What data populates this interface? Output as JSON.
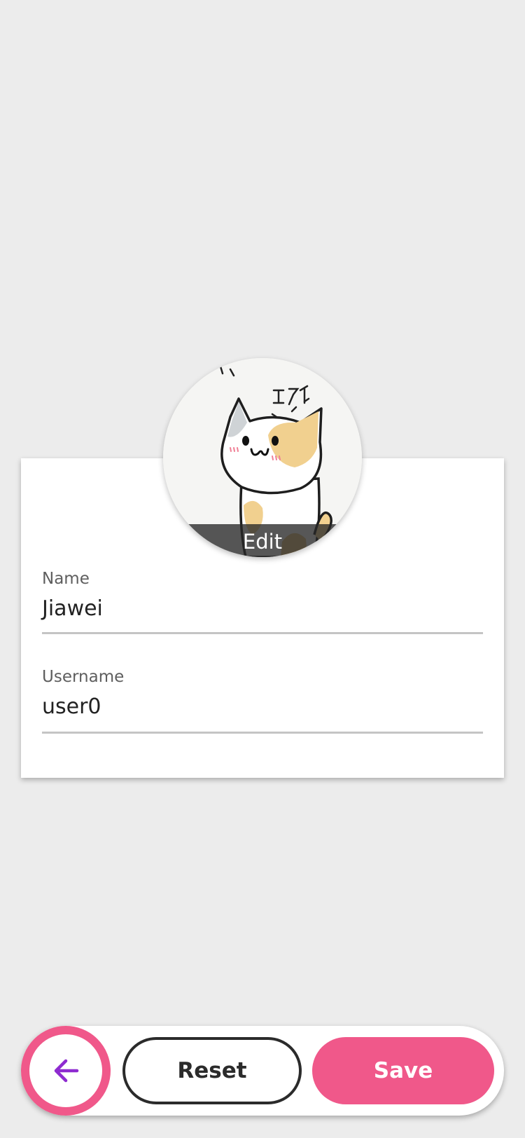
{
  "avatar": {
    "edit_label": "Edit"
  },
  "form": {
    "name": {
      "label": "Name",
      "value": "Jiawei"
    },
    "username": {
      "label": "Username",
      "value": "user0"
    }
  },
  "actions": {
    "back_icon": "arrow-left-icon",
    "reset_label": "Reset",
    "save_label": "Save"
  },
  "colors": {
    "background": "#ececec",
    "accent": "#f0588a",
    "back_arrow": "#8e2bd0",
    "card": "#ffffff"
  }
}
